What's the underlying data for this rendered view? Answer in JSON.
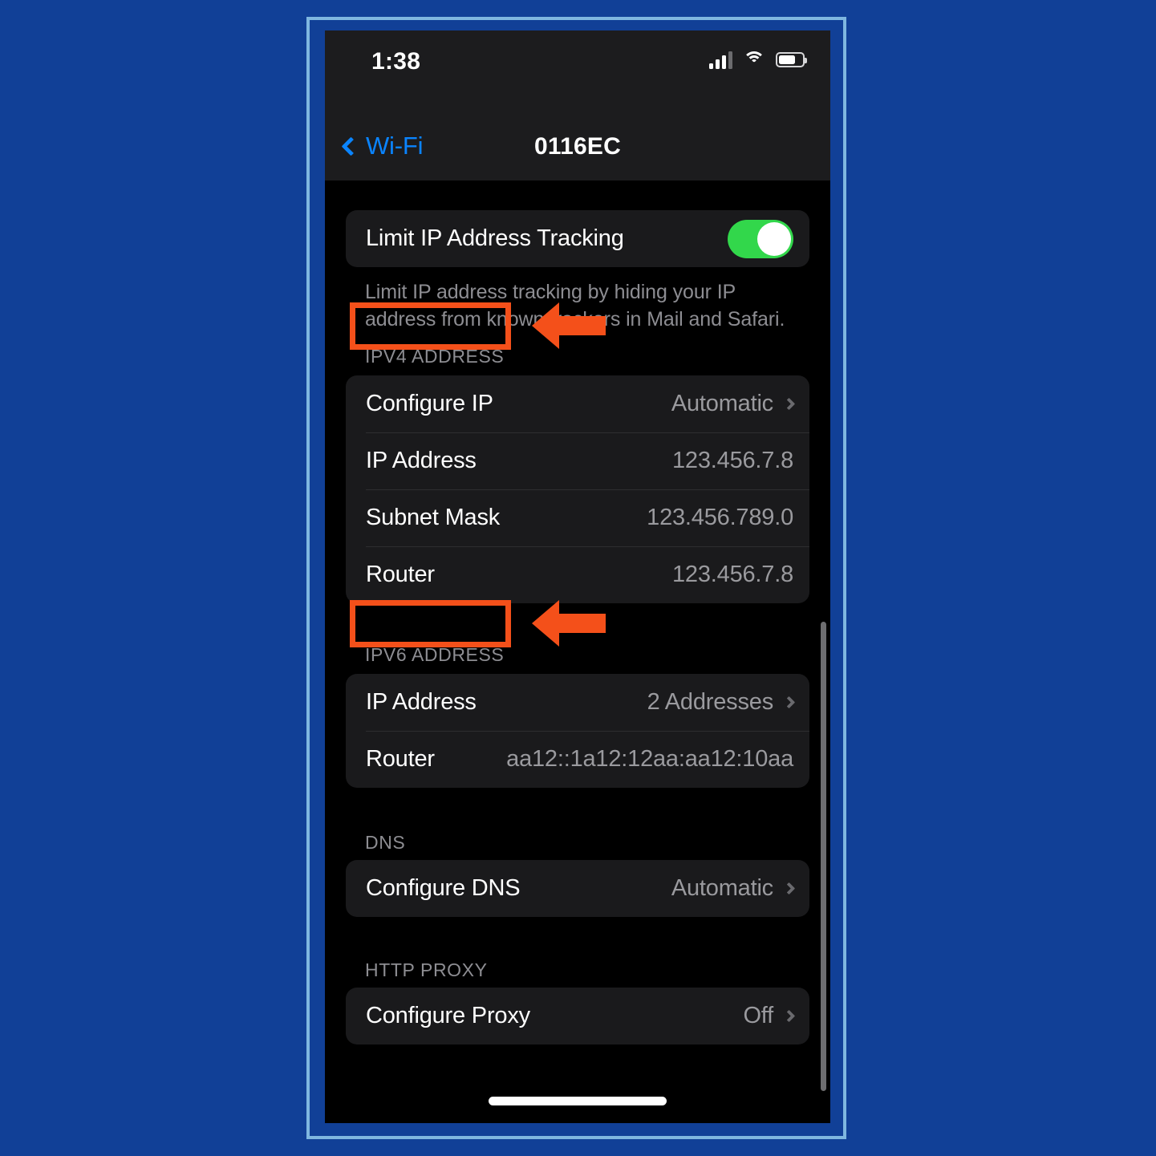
{
  "theme": {
    "page_background": "#114097",
    "frame_border": "#7fb7e0",
    "screen_background": "#000000",
    "card_background": "#1a1a1c",
    "accent_blue": "#0a84ff",
    "toggle_green": "#32d74b",
    "annotation_orange": "#f4501a",
    "secondary_text": "#8d8d92"
  },
  "status_bar": {
    "time": "1:38",
    "icons": [
      "cellular-signal-icon",
      "wifi-icon",
      "battery-icon"
    ]
  },
  "nav_bar": {
    "back_label": "Wi-Fi",
    "back_icon": "chevron-left-icon",
    "title": "0116EC"
  },
  "privacy": {
    "toggle_label": "Limit IP Address Tracking",
    "toggle_state": "on",
    "description": "Limit IP address tracking by hiding your IP address from known trackers in Mail and Safari."
  },
  "sections": [
    {
      "header": "IPV4 ADDRESS",
      "rows": [
        {
          "label": "Configure IP",
          "value": "Automatic",
          "chevron": true
        },
        {
          "label": "IP Address",
          "value": "123.456.7.8",
          "chevron": false
        },
        {
          "label": "Subnet Mask",
          "value": "123.456.789.0",
          "chevron": false
        },
        {
          "label": "Router",
          "value": "123.456.7.8",
          "chevron": false
        }
      ]
    },
    {
      "header": "IPV6 ADDRESS",
      "rows": [
        {
          "label": "IP Address",
          "value": "2 Addresses",
          "chevron": true
        },
        {
          "label": "Router",
          "value": "aa12::1a12:12aa:aa12:10aa",
          "chevron": false
        }
      ]
    },
    {
      "header": "DNS",
      "rows": [
        {
          "label": "Configure DNS",
          "value": "Automatic",
          "chevron": true
        }
      ]
    },
    {
      "header": "HTTP PROXY",
      "rows": [
        {
          "label": "Configure Proxy",
          "value": "Off",
          "chevron": true
        }
      ]
    }
  ],
  "annotations": [
    {
      "target": "IPV4 ADDRESS",
      "shape": "rectangle-highlight",
      "arrow": "arrow-left-icon",
      "color": "#f4501a"
    },
    {
      "target": "IPV6 ADDRESS",
      "shape": "rectangle-highlight",
      "arrow": "arrow-left-icon",
      "color": "#f4501a"
    }
  ]
}
